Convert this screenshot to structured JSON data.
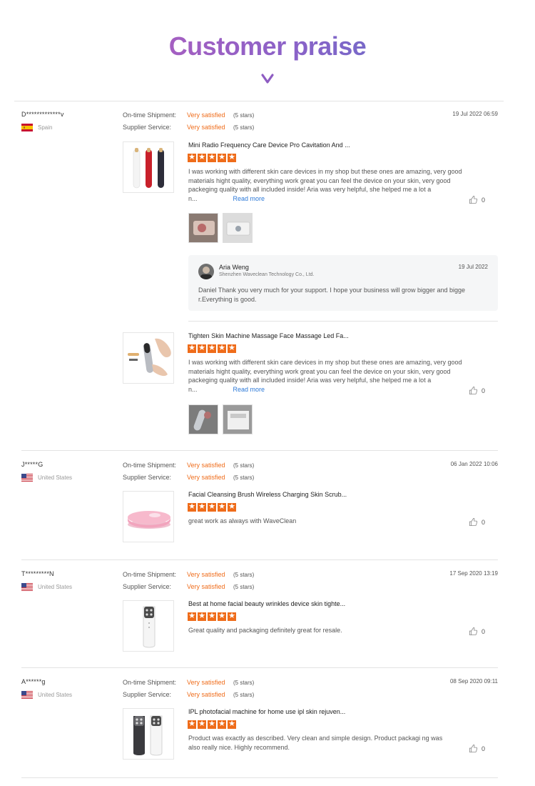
{
  "header": {
    "title": "Customer praise",
    "arrow_icon": "chevron-down-icon"
  },
  "colors": {
    "accent": "#ef6c1a",
    "link": "#2d7ad8",
    "title_gradient": [
      "#c85bb8",
      "#4f78c8"
    ]
  },
  "labels": {
    "ontime": "On-time Shipment:",
    "supplier": "Supplier Service:",
    "read_more": "Read more",
    "reply_name": "Aria Weng",
    "reply_company": "Shenzhen Waveclean Technology Co., Ltd."
  },
  "reviews": [
    {
      "user": "D*************v",
      "country": "Spain",
      "date": "19 Jul 2022 06:59",
      "ontime_value": "Very satisfied",
      "ontime_stars": "(5 stars)",
      "supplier_value": "Very satisfied",
      "supplier_stars": "(5 stars)",
      "items": [
        {
          "title": "Mini Radio Frequency Care Device Pro Cavitation And ...",
          "rating": 5,
          "text": "I was working with different skin care devices in my shop but these ones are amazing, very good materials hight quality, everything work great you can feel the device on your skin, very good packeging quality with all included inside! Aria was very helpful, she helped me a lot a n...",
          "likes": "0",
          "reply_date": "19 Jul 2022",
          "reply_text": "Daniel Thank you very much for your support. I hope your business will grow bigger and bigge r.Everything is good."
        },
        {
          "title": "Tighten Skin Machine Massage Face Massage Led Fa...",
          "rating": 5,
          "text": "I was working with different skin care devices in my shop but these ones are amazing, very good materials hight quality, everything work great you can feel the device on your skin, very good packeging quality with all included inside! Aria was very helpful, she helped me a lot a n...",
          "likes": "0"
        }
      ]
    },
    {
      "user": "J*****G",
      "country": "United States",
      "date": "06 Jan 2022 10:06",
      "ontime_value": "Very satisfied",
      "ontime_stars": "(5 stars)",
      "supplier_value": "Very satisfied",
      "supplier_stars": "(5 stars)",
      "items": [
        {
          "title": "Facial Cleansing Brush Wireless Charging Skin Scrub...",
          "rating": 5,
          "text": "great work as always with WaveClean",
          "likes": "0"
        }
      ]
    },
    {
      "user": "T*********N",
      "country": "United States",
      "date": "17 Sep 2020 13:19",
      "ontime_value": "Very satisfied",
      "ontime_stars": "(5 stars)",
      "supplier_value": "Very satisfied",
      "supplier_stars": "(5 stars)",
      "items": [
        {
          "title": "Best at home facial beauty wrinkles device skin tighte...",
          "rating": 5,
          "text": "Great quality and packaging definitely great for resale.",
          "likes": "0"
        }
      ]
    },
    {
      "user": "A******g",
      "country": "United States",
      "date": "08 Sep 2020 09:11",
      "ontime_value": "Very satisfied",
      "ontime_stars": "(5 stars)",
      "supplier_value": "Very satisfied",
      "supplier_stars": "(5 stars)",
      "items": [
        {
          "title": "IPL photofacial machine for home use ipl skin rejuven...",
          "rating": 5,
          "text": "Product was exactly as described. Very clean and simple design. Product packagi ng was also really nice. Highly recommend.",
          "likes": "0"
        }
      ]
    }
  ]
}
